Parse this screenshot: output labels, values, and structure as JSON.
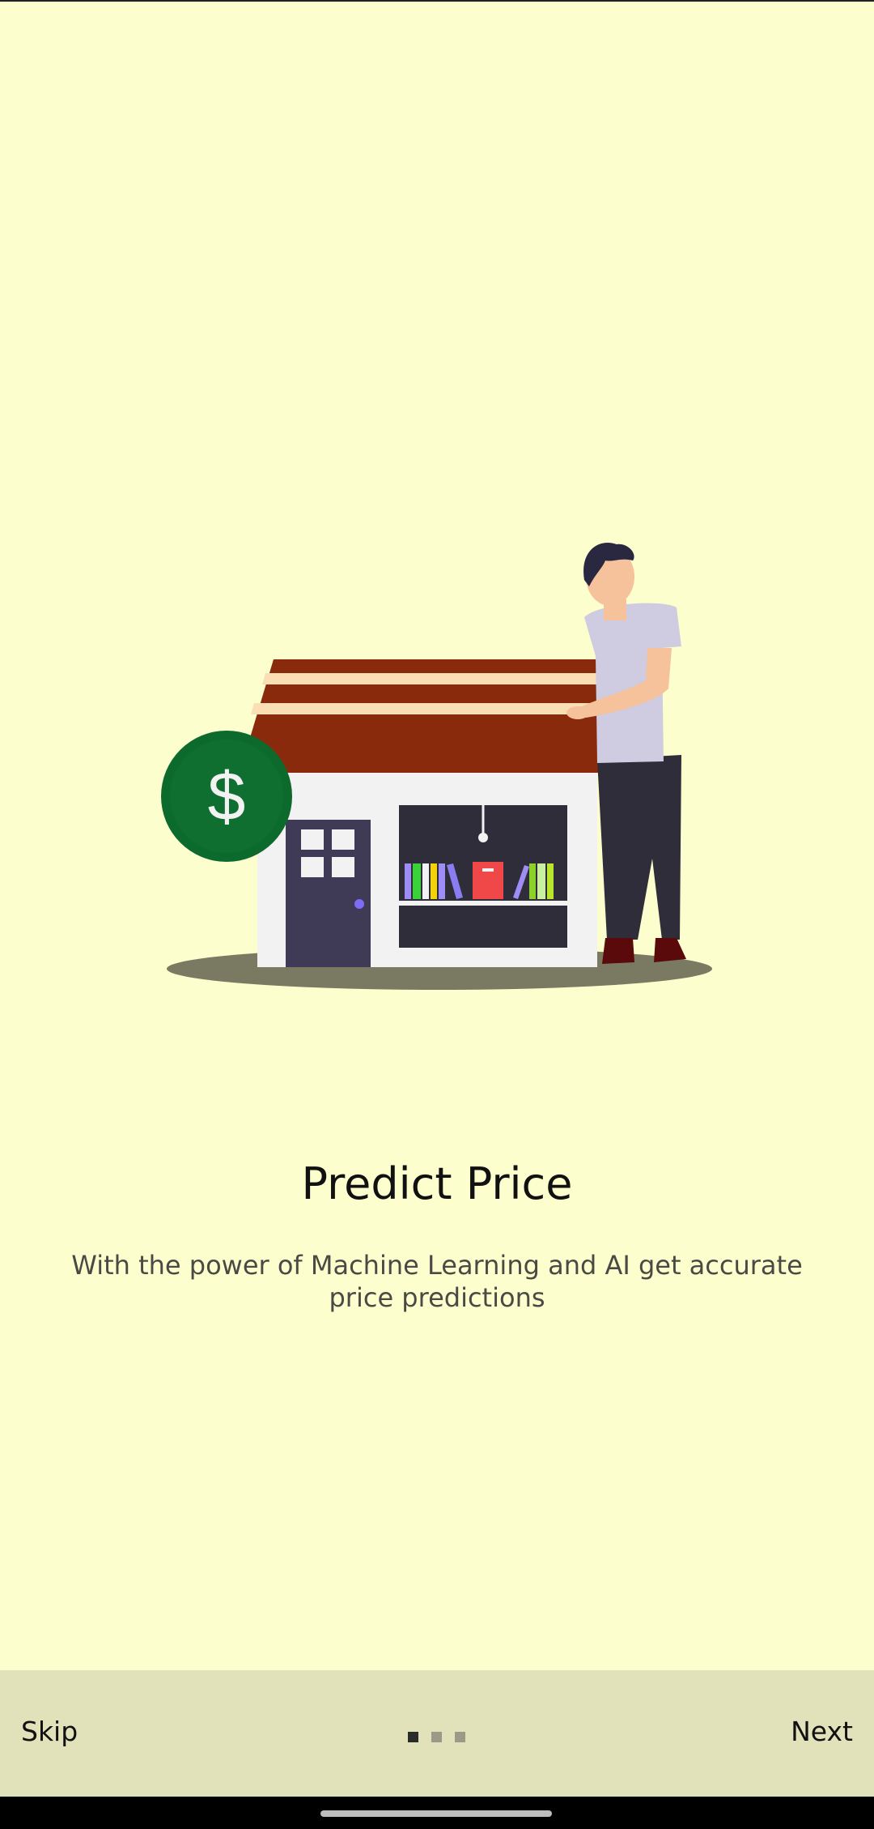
{
  "onboarding": {
    "title": "Predict Price",
    "description": "With the power of Machine Learning and AI get accurate price predictions",
    "illustration": {
      "icon": "house-with-person-and-dollar-coin-illustration",
      "coin_symbol": "$"
    },
    "page_indicator": {
      "count": 3,
      "current": 1
    }
  },
  "footer": {
    "skip_label": "Skip",
    "next_label": "Next"
  },
  "colors": {
    "background": "#fdfecd",
    "footer_background": "#e2e2ba",
    "roof": "#8a2a0c",
    "coin": "#0c6a2c",
    "door": "#3f3b57"
  }
}
